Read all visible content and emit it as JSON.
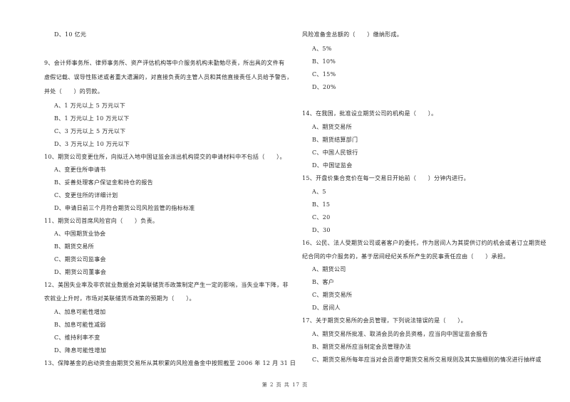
{
  "page": {
    "footer": "第 2 页 共 17 页"
  },
  "left_column": {
    "q8_tail_option_d": "D、10 亿元",
    "q9": {
      "lines": [
        "9、会计师事务所、律师事务所、资产评估机构等中介服务机构未勤勉尽责，所出具的文件有",
        "虚假记载、误导性陈述或者重大遗漏的，对直接负责的主管人员和其他直接责任人员给予警告，",
        "并处（　　）的罚款。"
      ],
      "options": [
        "A、1 万元以上 5 万元以下",
        "B、1 万元以上 10 万元以下",
        "C、3 万元以上 5 万元以下",
        "D、3 万元以上 10 万元以下"
      ]
    },
    "q10": {
      "lines": [
        "10、期货公司变更住所，向拟迁入地中国证监会派出机构提交的申请材料中不包括（　　）。"
      ],
      "options": [
        "A、变更住所申请书",
        "B、妥善处理客户保证金和持仓的报告",
        "C、变更住所的详细计划",
        "D、申请日前三个月符合期货公司风险监管的指标标准"
      ]
    },
    "q11": {
      "lines": [
        "11、期货公司首席风险官向（　　）负责。"
      ],
      "options": [
        "A、中国期货业协会",
        "B、期货交易所",
        "C、期货公司监事会",
        "D、期货公司董事会"
      ]
    },
    "q12": {
      "lines": [
        "12、美国失业率及非农就业数据会对美联储货币政策制定产生一定的影响，当失业率下降，非",
        "农就业上升时，市场对美联储货币政策的预期为（　　）。"
      ],
      "options": [
        "A、加息可能性增加",
        "B、加息可能性减弱",
        "C、维持利率不变",
        "D、降息可能性增加"
      ]
    },
    "q13_start": "13、保障基金的启动资金由期货交易所从其积累的风险准备金中按照截至 2006 年 12 月 31 日"
  },
  "right_column": {
    "q13_cont": {
      "lines": [
        "风险准备金总额的（　　）缴纳形成。"
      ],
      "options": [
        "A、5%",
        "B、10%",
        "C、15%",
        "D、20%"
      ]
    },
    "q14": {
      "lines": [
        "14、在我国，批准设立期货公司的机构是（　　）。"
      ],
      "options": [
        "A、期货交易所",
        "B、期货结算部门",
        "C、中国人民银行",
        "D、中国证监会"
      ]
    },
    "q15": {
      "lines": [
        "15、开盘价集合竞价在每一交易日开始前（　　）分钟内进行。"
      ],
      "options": [
        "A、5",
        "B、15",
        "C、20",
        "D、30"
      ]
    },
    "q16": {
      "lines": [
        "16、公民、法人受期货公司或者客户的委托，作为居间人为其提供订约的机会或者订立期货经",
        "纪合同的中介服务的，基于居间经纪关系所产生的民事责任应由（　　）承担。"
      ],
      "options": [
        "A、期货公司",
        "B、客户",
        "C、期货交易所",
        "D、居间人"
      ]
    },
    "q17": {
      "lines": [
        "17、关于期货交易所的会员管理，下列说法错误的是（　　）。"
      ],
      "options": [
        "A、期货交易所批准、取消会员的会员资格，应当向中国证监会报告",
        "B、期货交易所应当制定会员管理办法",
        "C、期货交易所每年应当对会员遵守期货交易所交易规则及其实施细则的情况进行抽样或"
      ]
    }
  }
}
